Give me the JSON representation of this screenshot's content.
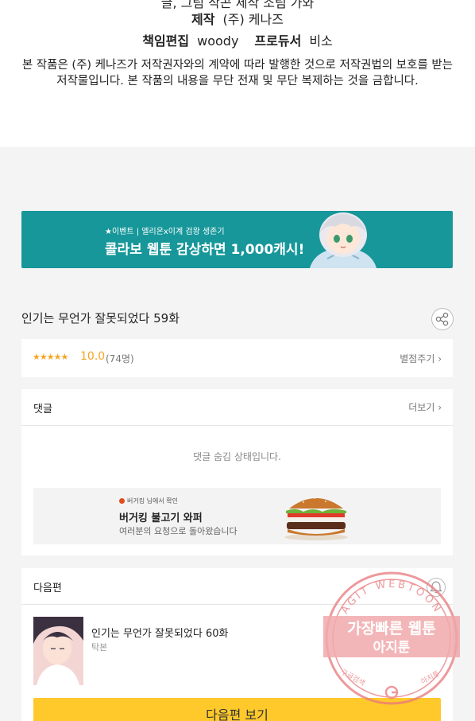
{
  "credits": {
    "cut_line": "글, 그림 작곤  제작 소림 가와",
    "production_label": "제작",
    "production_value": "(주) 케나즈",
    "editor_label": "책임편집",
    "editor_value": "woody",
    "producer_label": "프로듀서",
    "producer_value": "비소",
    "copyright": "본 작품은 (주) 케나즈가 저작권자와의 계약에 따라 발행한 것으로 저작권법의 보호를 받는 저작물입니다. 본 작품의 내용을 무단 전재 및 무단 복제하는 것을 금합니다."
  },
  "banner": {
    "small_text": "★이벤트 | 엘리온x이계 검왕 생존기",
    "big_text": "콜라보 웹툰 감상하면 1,000캐시!",
    "bg_color": "#17979a"
  },
  "episode": {
    "title": "인기는 무언가 잘못되었다 59화",
    "share_icon": "share-icon"
  },
  "rating": {
    "stars": "★★★★★",
    "score": "10.0",
    "count": "(74명)",
    "rate_link": "별점주기 ›",
    "star_color": "#f5a623"
  },
  "comments": {
    "header": "댓글",
    "more_link": "더보기 ›",
    "hidden_message": "댓글 숨김 상태입니다."
  },
  "ad": {
    "source": "버거킹 님에서 확인",
    "title": "버거킹 불고기 와퍼",
    "description": "여러분의 요청으로 돌아왔습니다"
  },
  "next": {
    "header": "다음편",
    "episode_title": "인기는 무언가 잘못되었다 60화",
    "episode_sub": "탁본",
    "button_label": "다음편 보기",
    "button_color": "#ffc92b"
  },
  "watermark": {
    "top_arc": "AGIT WEBTOON",
    "line1": "가장빠른 웹툰",
    "line2": "아지툰",
    "bottom_left": "구글검색",
    "bottom_right": "아지툰"
  }
}
